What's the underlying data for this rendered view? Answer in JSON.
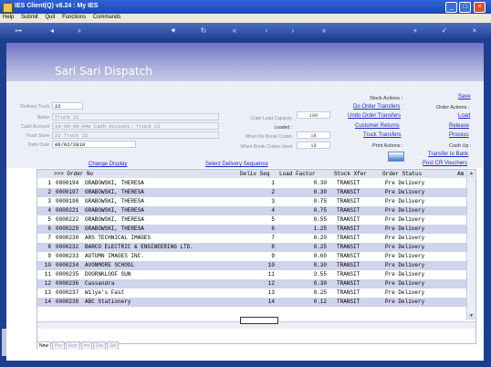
{
  "window": {
    "title": "IES Client(Q) v8.24 : My IES"
  },
  "menu": [
    "Help",
    "Submit",
    "Quit",
    "Functions",
    "Commands"
  ],
  "banner": {
    "title": "Sari Sari Dispatch"
  },
  "form": {
    "delivery_truck_label": "Delivery Truck",
    "delivery_truck_value": "22",
    "name_label": "Name",
    "name_value": "Truck 22",
    "cash_account_label": "Cash Account",
    "cash_account_value": "10-00-00-04e Cash Account: Truck 22",
    "truck_store_label": "Truck Store",
    "truck_store_value": "22 Truck 22",
    "deliv_date_label": "Deliv Date",
    "deliv_date_value": "06/02/2010",
    "crate_load_capacity_label": "Crate Load Capacity",
    "crate_load_capacity_value": "100",
    "loaded_label": "Loaded :",
    "when_no_break_label": "When No Break Crates",
    "when_no_break_value": "18",
    "when_break_label": "When Break Crates Used",
    "when_break_value": "18"
  },
  "actions": {
    "stock_actions": "Stock Actions :",
    "do_order_transfers": "Do Order Transfers",
    "undo_order_transfers": "Undo Order Transfers",
    "customer_returns": "Customer Returns",
    "truck_transfers": "Truck Transfers",
    "print_actions": "Print Actions :",
    "save": "Save",
    "order_actions": "Order Actions :",
    "load": "Load",
    "release": "Release",
    "process": "Process",
    "cash_up": "Cash Up :",
    "transfer_to_bank": "Transfer to Bank",
    "post_cr_vouchers": "Post CR Vouchers",
    "change_display": "Change Display",
    "select_delivery_sequence": "Select Delivery Sequence"
  },
  "grid": {
    "headers": [
      ">>> Order No",
      "Deliv Seq",
      "Load Factor",
      "Stock Xfer",
      "Order Status",
      "Am"
    ],
    "rows": [
      {
        "n": "1",
        "order": "0000194",
        "name": "GRABOWSKI, THERESA",
        "seq": "1",
        "load": "0.30",
        "xfer": "TRANSIT",
        "status": "Pre Delivery"
      },
      {
        "n": "2",
        "order": "0000197",
        "name": "GRABOWSKI, THERESA",
        "seq": "2",
        "load": "0.30",
        "xfer": "TRANSIT",
        "status": "Pre Delivery"
      },
      {
        "n": "3",
        "order": "0000198",
        "name": "GRABOWSKI, THERESA",
        "seq": "3",
        "load": "0.75",
        "xfer": "TRANSIT",
        "status": "Pre Delivery"
      },
      {
        "n": "4",
        "order": "0000221",
        "name": "GRABOWSKI, THERESA",
        "seq": "4",
        "load": "0.75",
        "xfer": "TRANSIT",
        "status": "Pre Delivery"
      },
      {
        "n": "5",
        "order": "0000222",
        "name": "GRABOWSKI, THERESA",
        "seq": "5",
        "load": "0.55",
        "xfer": "TRANSIT",
        "status": "Pre Delivery"
      },
      {
        "n": "6",
        "order": "0000229",
        "name": "GRABOWSKI, THERESA",
        "seq": "6",
        "load": "1.25",
        "xfer": "TRANSIT",
        "status": "Pre Delivery"
      },
      {
        "n": "7",
        "order": "0000230",
        "name": "ARS TECHNICAL IMAGES",
        "seq": "7",
        "load": "0.20",
        "xfer": "TRANSIT",
        "status": "Pre Delivery"
      },
      {
        "n": "8",
        "order": "0000232",
        "name": "BARCO ELECTRIC & ENGINEERING LTD.",
        "seq": "8",
        "load": "0.25",
        "xfer": "TRANSIT",
        "status": "Pre Delivery"
      },
      {
        "n": "9",
        "order": "0000233",
        "name": "AUTUMN IMAGES INC.",
        "seq": "9",
        "load": "0.60",
        "xfer": "TRANSIT",
        "status": "Pre Delivery"
      },
      {
        "n": "10",
        "order": "0000234",
        "name": "AVONMORE SCHOOL",
        "seq": "10",
        "load": "0.30",
        "xfer": "TRANSIT",
        "status": "Pre Delivery"
      },
      {
        "n": "11",
        "order": "0000235",
        "name": "DOORNKLOOF SUN",
        "seq": "11",
        "load": "3.55",
        "xfer": "TRANSIT",
        "status": "Pre Delivery"
      },
      {
        "n": "12",
        "order": "0000236",
        "name": "Cassandra",
        "seq": "12",
        "load": "0.30",
        "xfer": "TRANSIT",
        "status": "Pre Delivery"
      },
      {
        "n": "13",
        "order": "0000237",
        "name": "Wilye's Fast",
        "seq": "13",
        "load": "0.25",
        "xfer": "TRANSIT",
        "status": "Pre Delivery"
      },
      {
        "n": "14",
        "order": "0000238",
        "name": "ABC Stationery",
        "seq": "14",
        "load": "0.12",
        "xfer": "TRANSIT",
        "status": "Pre Delivery"
      }
    ]
  },
  "tabs": [
    "New",
    "Pre",
    "Actv",
    "Inv",
    "Del",
    "Sel"
  ]
}
